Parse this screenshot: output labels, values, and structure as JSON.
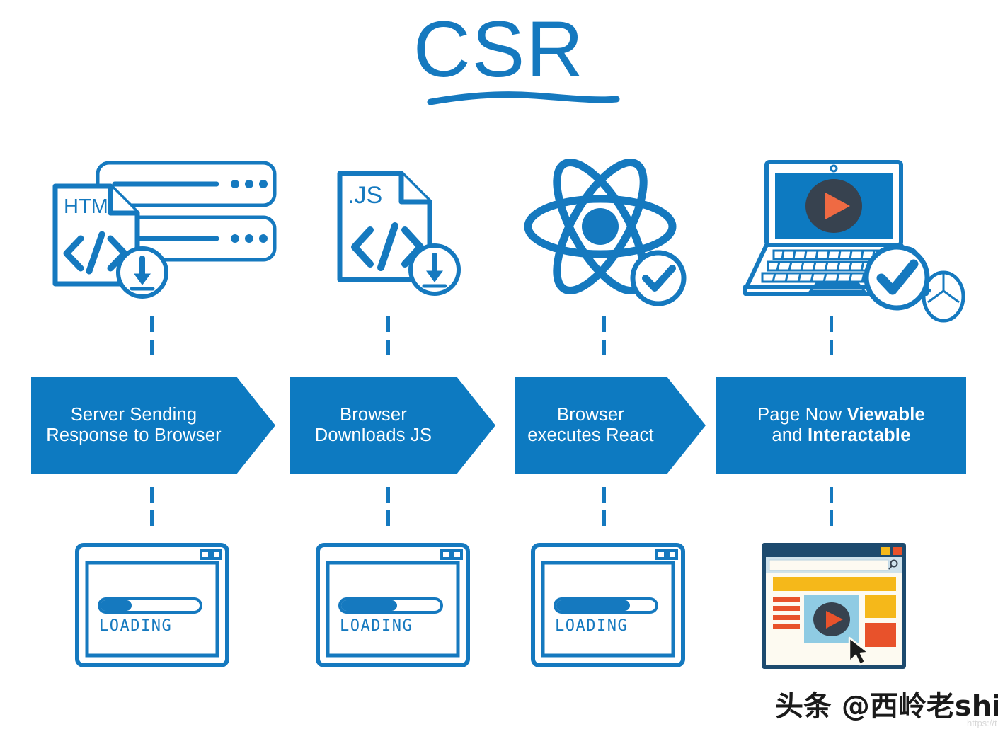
{
  "title": {
    "text": "CSR",
    "underline_icon": "underline-stroke"
  },
  "colors": {
    "brand_blue": "#1579bf",
    "banner_blue": "#0d7ac1",
    "sketch_blue": "#1579bf",
    "navy": "#1d4a6e",
    "yellow": "#f5b81a",
    "orange": "#e8522b",
    "play_orange": "#ef6a43",
    "dark_slate": "#37424f",
    "light_blue": "#8fcbe3",
    "cream": "#fdfaf1",
    "white": "#ffffff"
  },
  "steps": [
    {
      "id": "step-1",
      "icon_name": "html-file-server-icon",
      "icon_labels": {
        "file": "HTML",
        "code": "</>"
      },
      "badge": "download-arrow-badge",
      "banner_label": "Server Sending\nResponse to Browser",
      "banner_line1": "Server Sending",
      "banner_line2": "Response to Browser",
      "banner_shape": "arrow",
      "mock_name": "loading-browser-window",
      "mock_label": "LOADING",
      "progress_percent": 30
    },
    {
      "id": "step-2",
      "icon_name": "js-file-icon",
      "icon_labels": {
        "file": ".JS",
        "code": "</>"
      },
      "badge": "download-arrow-badge",
      "banner_label": "Browser\nDownloads JS",
      "banner_line1": "Browser",
      "banner_line2": "Downloads JS",
      "banner_shape": "arrow",
      "mock_name": "loading-browser-window",
      "mock_label": "LOADING",
      "progress_percent": 55
    },
    {
      "id": "step-3",
      "icon_name": "react-atom-icon",
      "icon_labels": {
        "file": "",
        "code": ""
      },
      "badge": "check-badge",
      "banner_label": "Browser\nexecutes React",
      "banner_line1": "Browser",
      "banner_line2": "executes React",
      "banner_shape": "arrow",
      "mock_name": "loading-browser-window",
      "mock_label": "LOADING",
      "progress_percent": 72
    },
    {
      "id": "step-4",
      "icon_name": "laptop-mouse-icon",
      "icon_labels": {
        "file": "",
        "code": ""
      },
      "badge": "check-badge",
      "banner_label": "Page Now Viewable and Interactable",
      "banner_line1_plain": "Page Now ",
      "banner_line1_bold": "Viewable",
      "banner_line2_plain": "and ",
      "banner_line2_bold": "Interactable",
      "banner_shape": "rectangle",
      "mock_name": "rendered-page-window",
      "mock_label": "",
      "progress_percent": 100
    }
  ],
  "rendered_page": {
    "window_buttons": [
      "minimize-yellow",
      "close-orange"
    ],
    "search_placeholder": "",
    "search_icon": "magnifier-icon",
    "play_icon": "play-button-icon",
    "cursor_icon": "mouse-pointer-icon",
    "list_line_count": 4,
    "blocks": [
      "yellow-banner",
      "yellow-block",
      "orange-block",
      "video-panel"
    ]
  },
  "watermark": {
    "text": "头条 @西岭老shi",
    "url": "https://t"
  }
}
